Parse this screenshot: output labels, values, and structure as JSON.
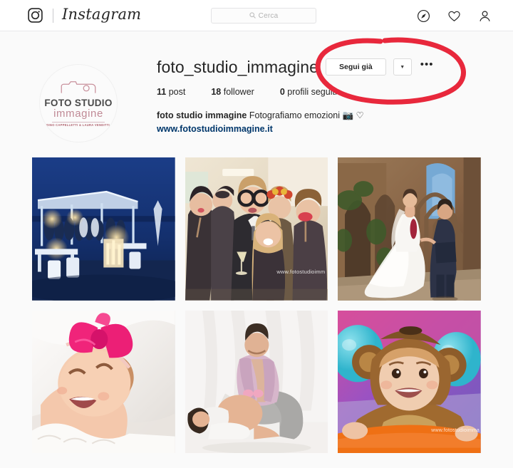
{
  "navbar": {
    "logo_icon": "instagram-camera-icon",
    "wordmark": "Instagram",
    "search": {
      "placeholder": "Cerca",
      "value": "",
      "icon": "search-icon"
    },
    "icons": [
      {
        "name": "explore-compass-icon",
        "label": "Esplora"
      },
      {
        "name": "activity-heart-icon",
        "label": "Attività"
      },
      {
        "name": "profile-person-icon",
        "label": "Profilo"
      }
    ]
  },
  "profile": {
    "avatar": {
      "name": "profile-avatar",
      "logo_line1": "FOTO STUDIO",
      "logo_line2": "immagine",
      "logo_line3": "DINO CAPPELLETTI & LAURA VENDITTI",
      "camera_icon": "camera-outline-icon"
    },
    "username": "foto_studio_immagine",
    "follow_button": "Segui già",
    "caret_button": "▼",
    "more_button": "•••",
    "stats": [
      {
        "value": "11",
        "label": "post"
      },
      {
        "value": "18",
        "label": "follower"
      },
      {
        "value": "0",
        "label": "profili seguiti"
      }
    ],
    "bio_name": "foto studio immagine",
    "bio_text": "Fotografiamo emozioni 📷 ♡",
    "website": "www.fotostudioimmagine.it"
  },
  "grid": {
    "posts": [
      {
        "name": "post-beach-wedding-reception",
        "alt": "Ricevimento in spiaggia al tramonto",
        "watermark": ""
      },
      {
        "name": "post-photobooth-group",
        "alt": "Gruppo con gadget photo booth",
        "watermark": "www.fotostudioimm"
      },
      {
        "name": "post-bride-groom-ruins",
        "alt": "Sposi tra le rovine gotiche",
        "watermark": ""
      },
      {
        "name": "post-newborn-pink-bow",
        "alt": "Neonata con fiocco rosa",
        "watermark": ""
      },
      {
        "name": "post-maternity-couple",
        "alt": "Servizio maternità in studio",
        "watermark": ""
      },
      {
        "name": "post-baby-monkey-costume",
        "alt": "Bimbo in costume da scimmietta",
        "watermark": "www.fotostudioimma"
      }
    ]
  },
  "annotation": {
    "name": "red-circle-annotation",
    "shape": "hand-drawn-ellipse",
    "color": "#e8283c"
  }
}
